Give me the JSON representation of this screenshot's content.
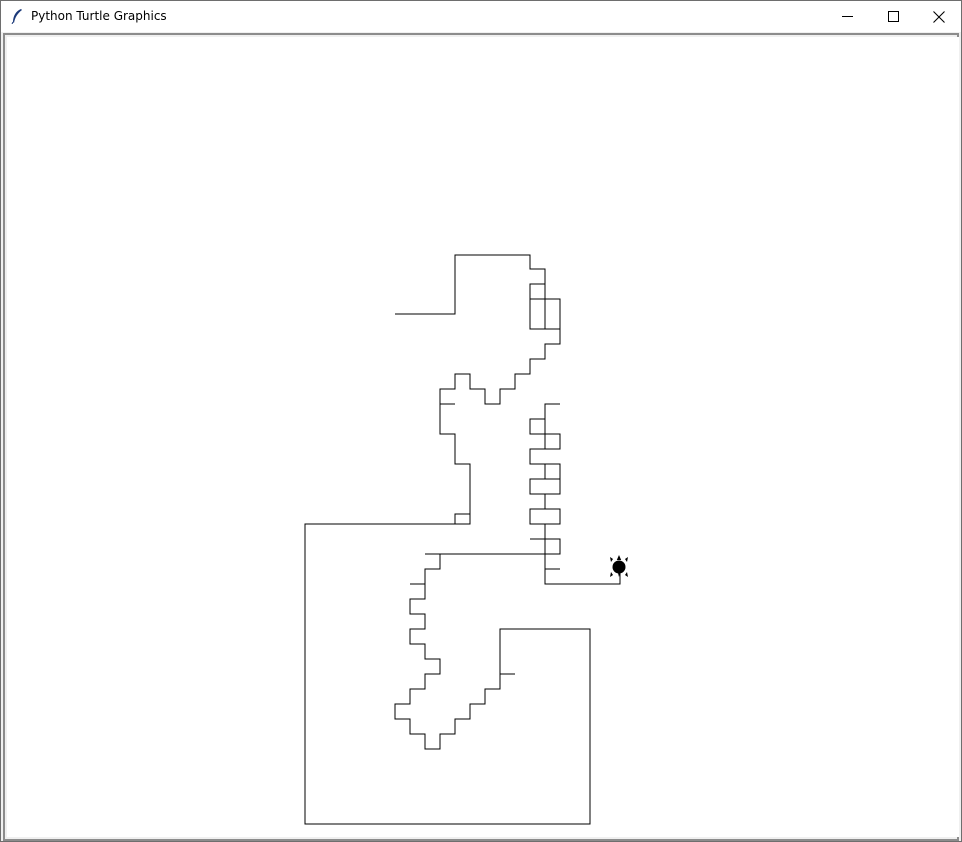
{
  "window": {
    "title": "Python Turtle Graphics",
    "app_icon": "feather-icon",
    "controls": [
      "minimize-icon",
      "maximize-icon",
      "close-icon"
    ]
  },
  "canvas": {
    "background": "#ffffff",
    "pen_color": "#000000",
    "turtle_icon": "turtle-icon",
    "turtle_color": "#000000"
  }
}
